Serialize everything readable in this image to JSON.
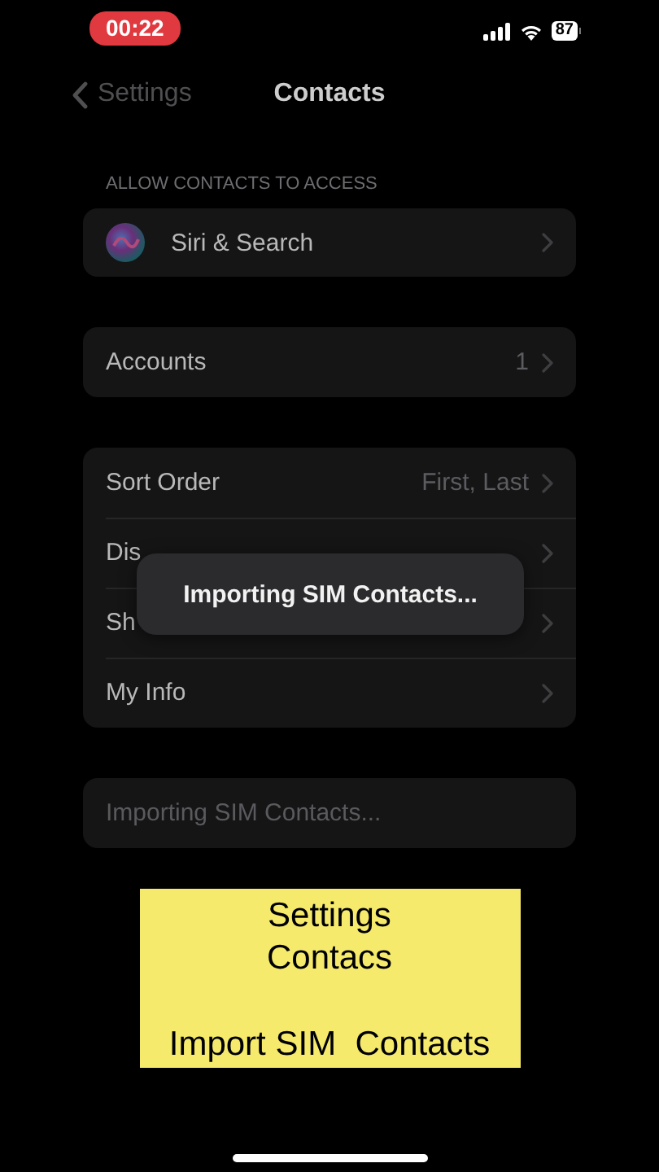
{
  "status_bar": {
    "time": "00:22",
    "battery": "87"
  },
  "nav": {
    "back": "Settings",
    "title": "Contacts"
  },
  "groups": [
    {
      "header": "ALLOW CONTACTS TO ACCESS",
      "rows": [
        {
          "kind": "siri",
          "label": "Siri & Search"
        }
      ]
    },
    {
      "rows": [
        {
          "kind": "plain",
          "label": "Accounts",
          "value": "1"
        }
      ]
    },
    {
      "rows": [
        {
          "kind": "plain",
          "label": "Sort Order",
          "value": "First, Last"
        },
        {
          "kind": "plain",
          "label": "Dis"
        },
        {
          "kind": "plain",
          "label": "Sh"
        },
        {
          "kind": "plain",
          "label": "My Info"
        }
      ],
      "hud": "Importing SIM Contacts..."
    }
  ],
  "import_button": {
    "label": "Importing SIM Contacts...",
    "disabled": true
  },
  "caption": [
    "Settings",
    "Contacs",
    "Import SIM  Contacts"
  ]
}
